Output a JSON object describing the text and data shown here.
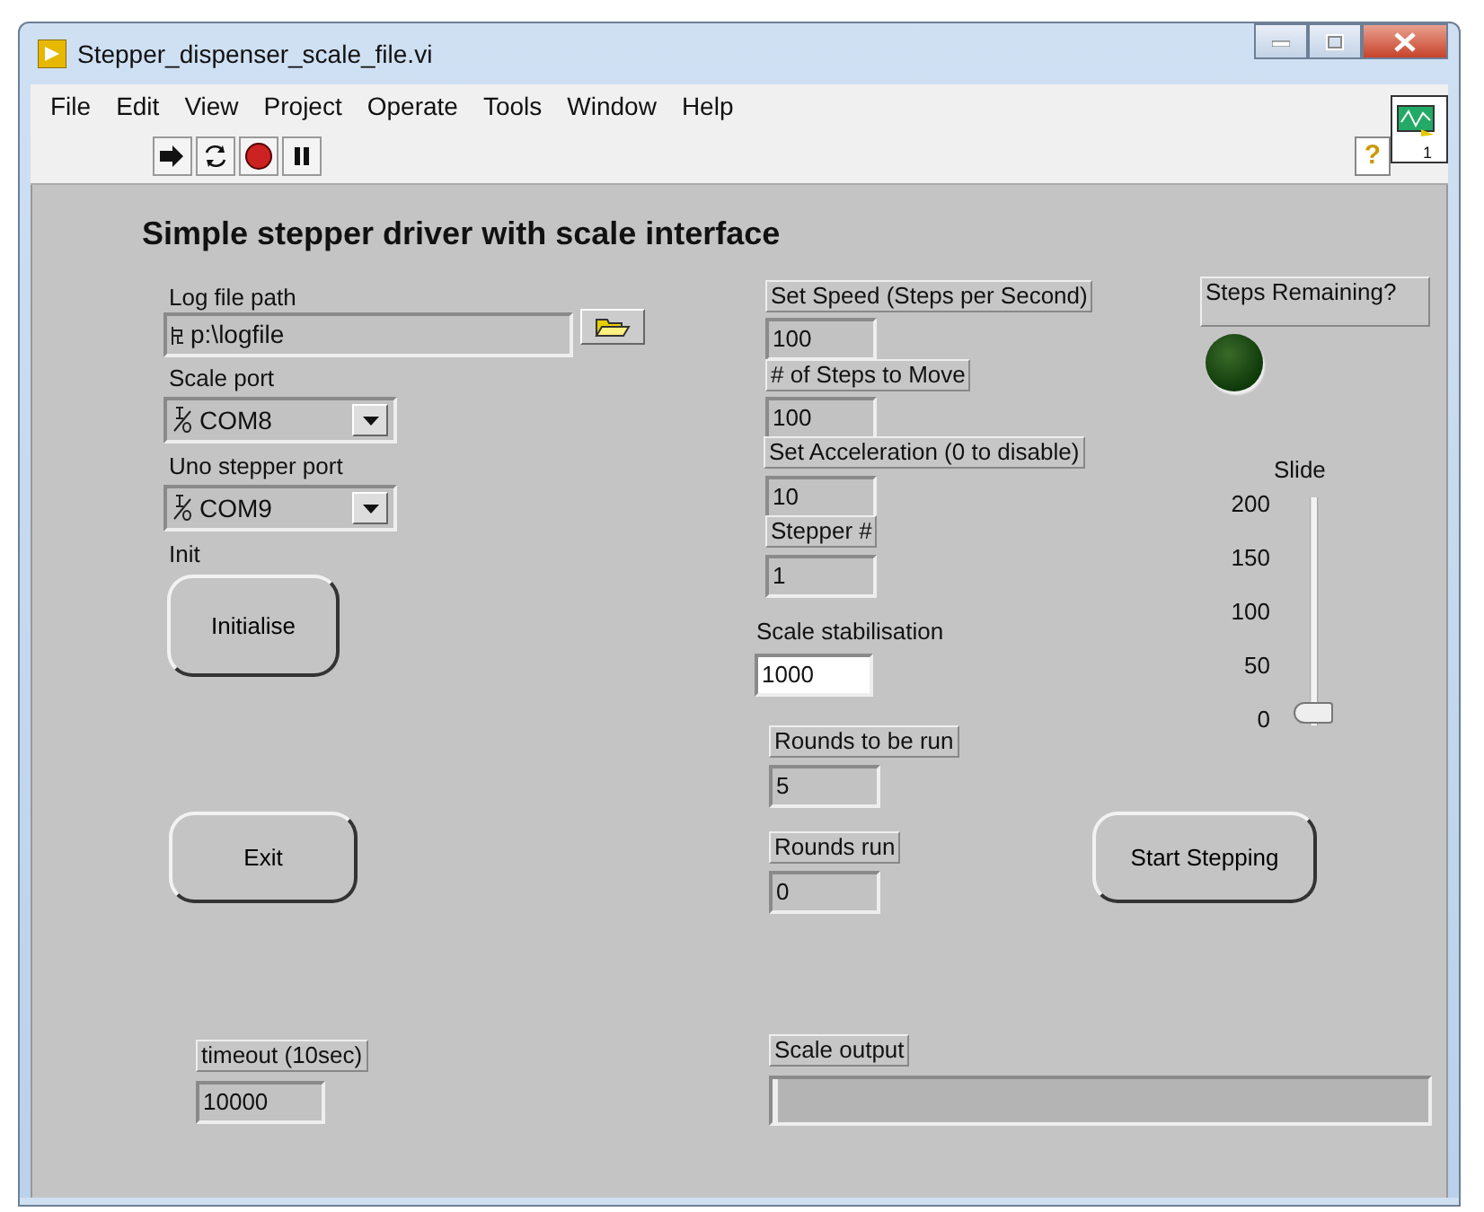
{
  "window": {
    "title": "Stepper_dispenser_scale_file.vi"
  },
  "menu": [
    "File",
    "Edit",
    "View",
    "Project",
    "Operate",
    "Tools",
    "Window",
    "Help"
  ],
  "toolbar": {
    "help": "?",
    "vi_icon_number": "1"
  },
  "panel": {
    "title": "Simple stepper driver with scale interface"
  },
  "controls": [
    {
      "kind": "path",
      "label": "Log file path",
      "value": "p:\\logfile"
    },
    {
      "kind": "indicator",
      "label": "Set Speed (Steps per Second)",
      "value": "100"
    },
    {
      "kind": "led",
      "label": "Steps Remaining?",
      "on": false
    },
    {
      "kind": "ring",
      "label": "Scale port",
      "value": "COM8"
    },
    {
      "kind": "indicator",
      "label": "# of Steps to Move",
      "value": "100"
    },
    {
      "kind": "ring",
      "label": "Uno stepper port",
      "value": "COM9"
    },
    {
      "kind": "indicator",
      "label": "Set Acceleration (0 to disable)",
      "value": "10"
    },
    {
      "kind": "button",
      "label": "Init",
      "caption": "Initialise"
    },
    {
      "kind": "indicator",
      "label": "Stepper #",
      "value": "1"
    },
    {
      "kind": "control",
      "label": "Scale stabilisation",
      "value": "1000"
    },
    {
      "kind": "indicator",
      "label": "Rounds to be run",
      "value": "5"
    },
    {
      "kind": "button",
      "caption": "Exit"
    },
    {
      "kind": "indicator",
      "label": "Rounds run",
      "value": "0"
    },
    {
      "kind": "button",
      "caption": "Start Stepping"
    },
    {
      "kind": "slider",
      "label": "Slide",
      "ticks": [
        "200",
        "150",
        "100",
        "50",
        "0"
      ],
      "level": 0
    },
    {
      "kind": "indicator",
      "label": "timeout (10sec)",
      "value": "10000"
    },
    {
      "kind": "progress",
      "label": "Scale output",
      "level": 0
    }
  ]
}
